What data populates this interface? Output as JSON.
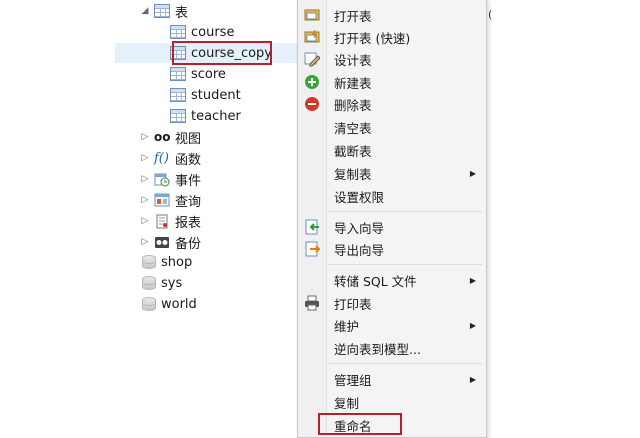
{
  "tree": {
    "tables_node": "表",
    "tables": [
      "course",
      "course_copy",
      "score",
      "student",
      "teacher"
    ],
    "selected_table": "course_copy",
    "groups": [
      "视图",
      "函数",
      "事件",
      "查询",
      "报表",
      "备份"
    ],
    "databases": [
      "shop",
      "sys",
      "world"
    ]
  },
  "menu": {
    "open_table": "打开表",
    "open_table_fast": "打开表 (快速)",
    "design_table": "设计表",
    "new_table": "新建表",
    "delete_table": "删除表",
    "empty_table": "清空表",
    "truncate_table": "截断表",
    "copy_table": "复制表",
    "set_permissions": "设置权限",
    "import_wizard": "导入向导",
    "export_wizard": "导出向导",
    "dump_sql": "转储 SQL 文件",
    "print_table": "打印表",
    "maintain": "维护",
    "reverse_to_model": "逆向表到模型...",
    "manage_group": "管理组",
    "copy": "复制",
    "rename": "重命名"
  },
  "colors": {
    "highlight_box": "#b8202a",
    "selection": "#e6f0fb"
  }
}
